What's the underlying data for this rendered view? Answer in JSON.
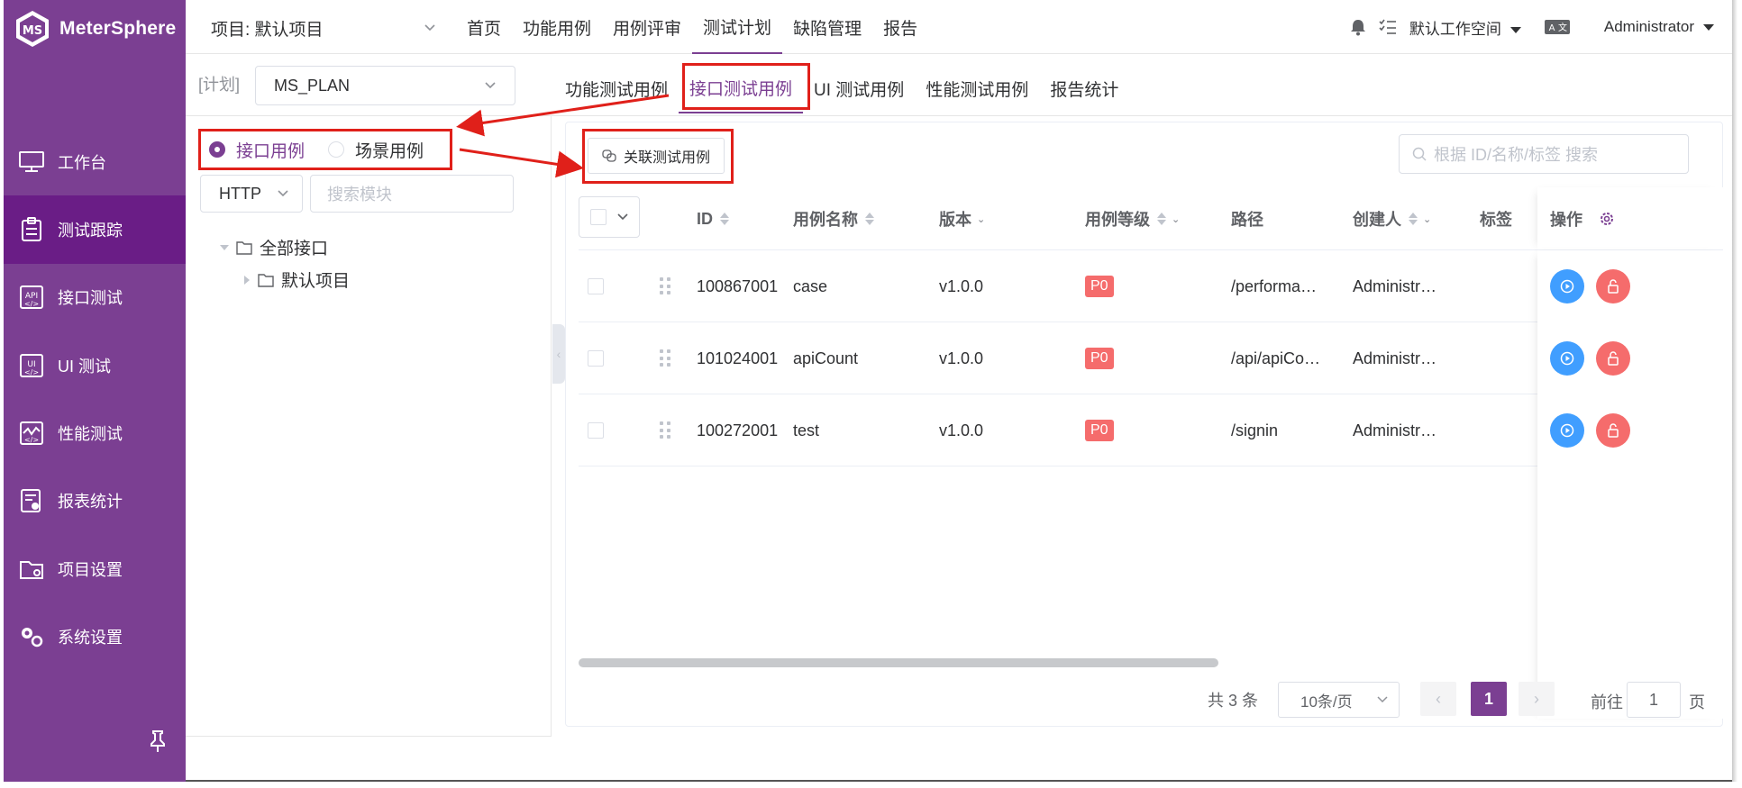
{
  "brand": {
    "name": "MeterSphere",
    "color": "#7b3f92"
  },
  "sidebar": {
    "items": [
      {
        "label": "工作台",
        "icon": "desktop-icon"
      },
      {
        "label": "测试跟踪",
        "icon": "clipboard-icon",
        "active": true
      },
      {
        "label": "接口测试",
        "icon": "api-icon"
      },
      {
        "label": "UI 测试",
        "icon": "ui-icon"
      },
      {
        "label": "性能测试",
        "icon": "chart-icon"
      },
      {
        "label": "报表统计",
        "icon": "report-icon"
      },
      {
        "label": "项目设置",
        "icon": "folder-icon"
      },
      {
        "label": "系统设置",
        "icon": "gears-icon"
      }
    ]
  },
  "header": {
    "project": "项目: 默认项目",
    "menu": [
      "首页",
      "功能用例",
      "用例评审",
      "测试计划",
      "缺陷管理",
      "报告"
    ],
    "active_menu": "测试计划",
    "workspace": "默认工作空间",
    "user": "Administrator"
  },
  "plan": {
    "label": "[计划]",
    "value": "MS_PLAN"
  },
  "sub_tabs": [
    "功能测试用例",
    "接口测试用例",
    "UI 测试用例",
    "性能测试用例",
    "报告统计"
  ],
  "left": {
    "radio": [
      "接口用例",
      "场景用例"
    ],
    "protocol": "HTTP",
    "module_search_placeholder": "搜索模块",
    "tree": {
      "root": "全部接口",
      "child": "默认项目"
    }
  },
  "toolbar": {
    "link_button": "关联测试用例",
    "search_placeholder": "根据 ID/名称/标签 搜索"
  },
  "table": {
    "headers": {
      "id": "ID",
      "name": "用例名称",
      "version": "版本",
      "level": "用例等级",
      "path": "路径",
      "creator": "创建人",
      "tags": "标签",
      "ops": "操作"
    },
    "rows": [
      {
        "id": "100867001",
        "name": "case",
        "version": "v1.0.0",
        "level": "P0",
        "path": "/performa…",
        "creator": "Administr…"
      },
      {
        "id": "101024001",
        "name": "apiCount",
        "version": "v1.0.0",
        "level": "P0",
        "path": "/api/apiCo…",
        "creator": "Administr…"
      },
      {
        "id": "100272001",
        "name": "test",
        "version": "v1.0.0",
        "level": "P0",
        "path": "/signin",
        "creator": "Administr…"
      }
    ]
  },
  "pagination": {
    "total": "共 3 条",
    "page_size": "10条/页",
    "current": "1",
    "goto_label": "前往",
    "goto_value": "1",
    "page_suffix": "页"
  }
}
